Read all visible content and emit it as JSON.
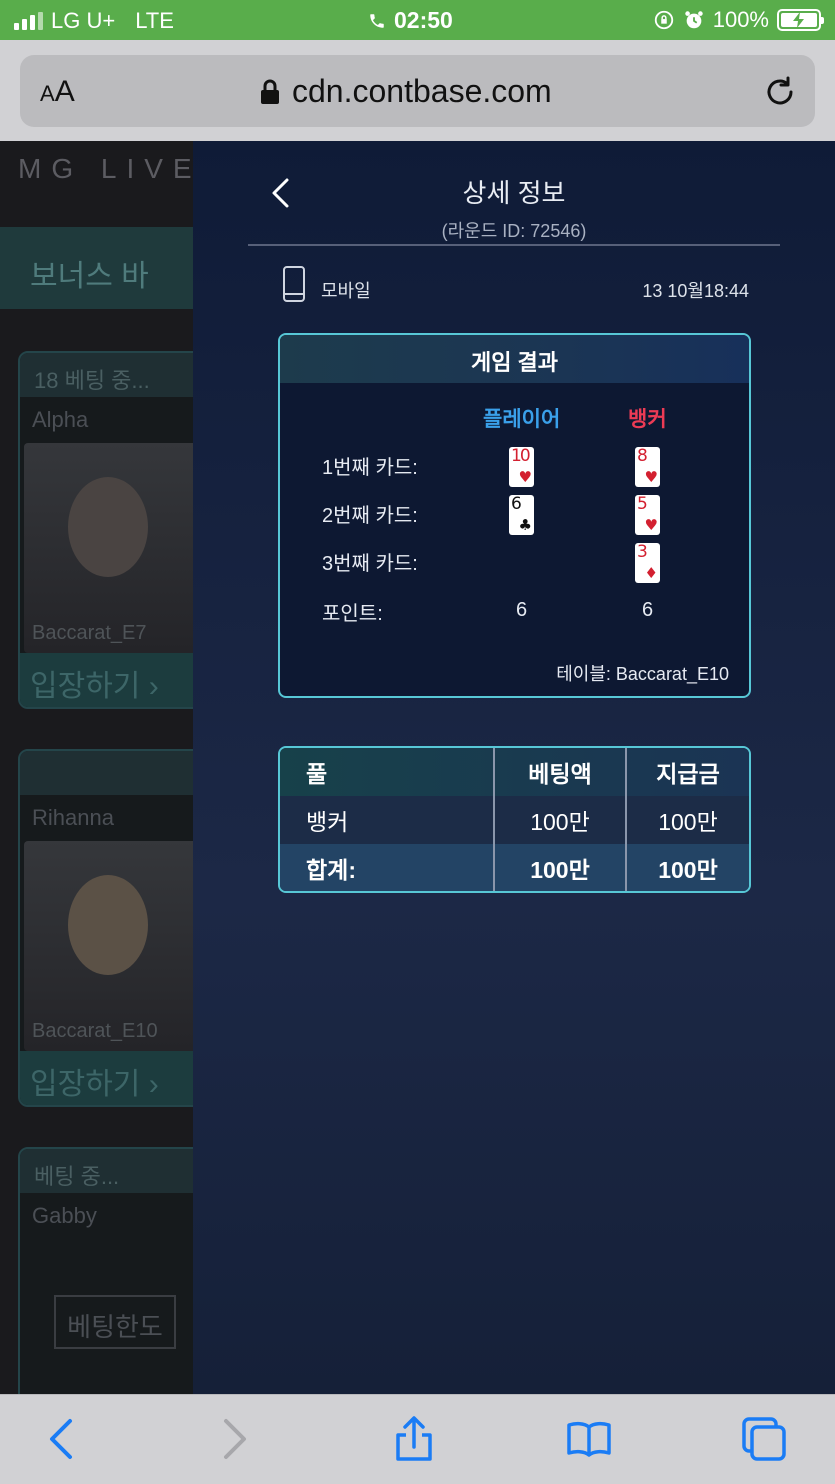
{
  "status_bar": {
    "carrier": "LG U+",
    "network": "LTE",
    "time": "02:50",
    "battery": "100%",
    "icons": [
      "signal-icon",
      "phone-icon",
      "rotation-lock-icon",
      "alarm-icon",
      "battery-charging-icon"
    ]
  },
  "browser": {
    "text_size_label_small": "A",
    "text_size_label_large": "A",
    "url": "cdn.contbase.com",
    "icons": [
      "lock-icon",
      "reload-icon"
    ]
  },
  "lobby": {
    "logo": "MG LIVE",
    "bonus_label": "보너스 바",
    "cards": [
      {
        "header": "18  베팅 중...",
        "dealer": "Alpha",
        "table": "Baccarat_E7",
        "enter": "입장하기 ›"
      },
      {
        "header": "",
        "dealer": "Rihanna",
        "table": "Baccarat_E10",
        "enter": "입장하기 ›"
      },
      {
        "header": "베팅 중...",
        "dealer": "Gabby",
        "table": "",
        "enter": "베팅한도"
      }
    ]
  },
  "detail": {
    "title": "상세 정보",
    "subtitle": "(라운드 ID: 72546)",
    "device": "모바일",
    "datetime": "13 10월18:44",
    "result": {
      "header": "게임 결과",
      "player_label": "플레이어",
      "banker_label": "뱅커",
      "rows": [
        {
          "label": "1번째  카드:"
        },
        {
          "label": "2번째  카드:"
        },
        {
          "label": "3번째  카드:"
        }
      ],
      "points_label": "포인트:",
      "player_cards": [
        {
          "rank": "10",
          "suit": "♥",
          "color": "#d32030"
        },
        {
          "rank": "6",
          "suit": "♣",
          "color": "#111111"
        }
      ],
      "banker_cards": [
        {
          "rank": "8",
          "suit": "♥",
          "color": "#d32030"
        },
        {
          "rank": "5",
          "suit": "♥",
          "color": "#d32030"
        },
        {
          "rank": "3",
          "suit": "♦",
          "color": "#d32030"
        }
      ],
      "player_points": "6",
      "banker_points": "6",
      "table": "테이블: Baccarat_E10"
    },
    "bets": {
      "headers": [
        "풀",
        "베팅액",
        "지급금"
      ],
      "rows": [
        [
          "뱅커",
          "100만",
          "100만"
        ]
      ],
      "total": [
        "합계:",
        "100만",
        "100만"
      ]
    }
  },
  "toolbar": {
    "icons": [
      "back-icon",
      "forward-icon",
      "share-icon",
      "bookmarks-icon",
      "tabs-icon"
    ]
  }
}
